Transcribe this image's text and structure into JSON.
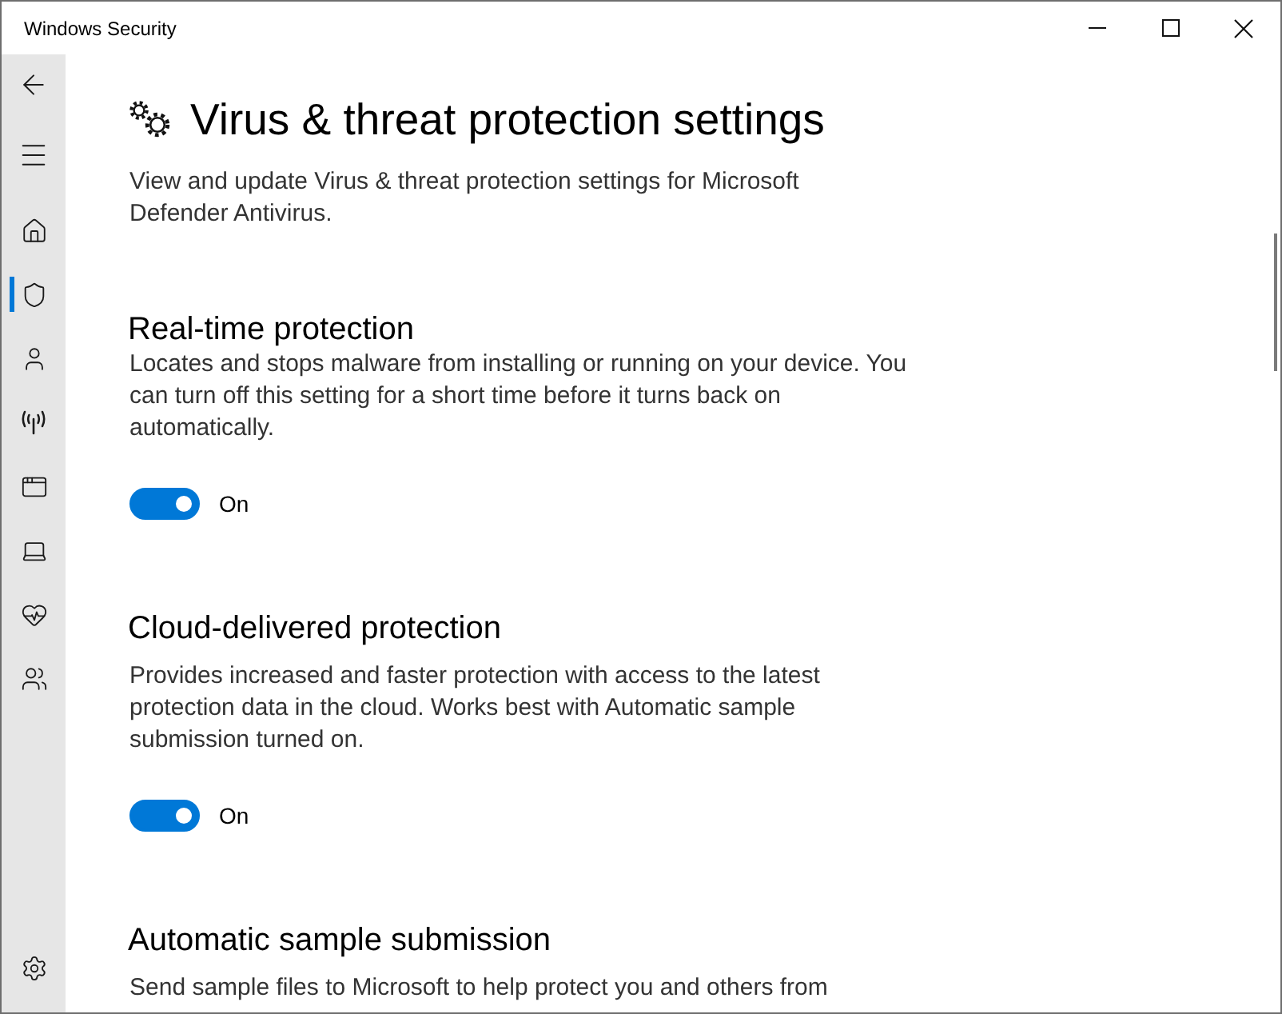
{
  "window": {
    "title": "Windows Security"
  },
  "sidebar": {
    "items": [
      {
        "selected": false
      },
      {
        "selected": true
      },
      {
        "selected": false
      },
      {
        "selected": false
      },
      {
        "selected": false
      },
      {
        "selected": false
      },
      {
        "selected": false
      },
      {
        "selected": false
      }
    ],
    "settings": {
      "selected": false
    }
  },
  "page": {
    "title": "Virus & threat protection settings",
    "description": "View and update Virus & threat protection settings for Microsoft Defender Antivirus."
  },
  "sections": [
    {
      "heading": "Real-time protection",
      "description": "Locates and stops malware from installing or running on your device. You can turn off this setting for a short time before it turns back on automatically.",
      "toggle": {
        "on": true,
        "label": "On"
      }
    },
    {
      "heading": "Cloud-delivered protection",
      "description": "Provides increased and faster protection with access to the latest protection data in the cloud. Works best with Automatic sample submission turned on.",
      "toggle": {
        "on": true,
        "label": "On"
      }
    },
    {
      "heading": "Automatic sample submission",
      "description": "Send sample files to Microsoft to help protect you and others from"
    }
  ]
}
